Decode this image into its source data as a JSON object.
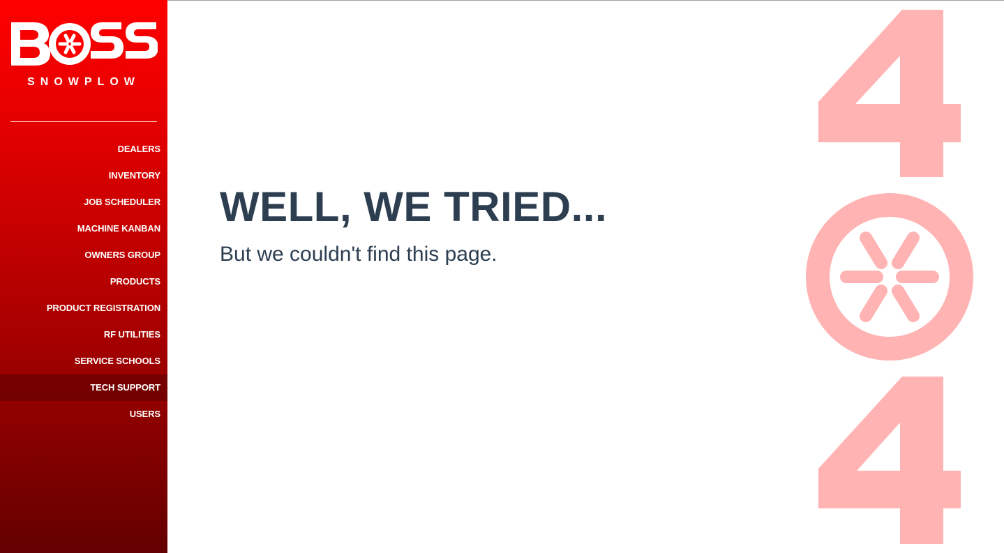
{
  "brand": {
    "name": "BOSS",
    "tagline": "SNOWPLOW",
    "color": "#ff0000"
  },
  "sidebar": {
    "items": [
      {
        "label": "DEALERS"
      },
      {
        "label": "INVENTORY"
      },
      {
        "label": "JOB SCHEDULER"
      },
      {
        "label": "MACHINE KANBAN"
      },
      {
        "label": "OWNERS GROUP"
      },
      {
        "label": "PRODUCTS"
      },
      {
        "label": "PRODUCT REGISTRATION"
      },
      {
        "label": "RF UTILITIES"
      },
      {
        "label": "SERVICE SCHOOLS"
      },
      {
        "label": "TECH SUPPORT",
        "active": true
      },
      {
        "label": "USERS"
      }
    ]
  },
  "error": {
    "headline": "WELL, WE TRIED...",
    "message": "But we couldn't find this page.",
    "code_digits": [
      "4",
      "0",
      "4"
    ],
    "art_color": "#ffb3b3",
    "text_color": "#2c3e50"
  }
}
